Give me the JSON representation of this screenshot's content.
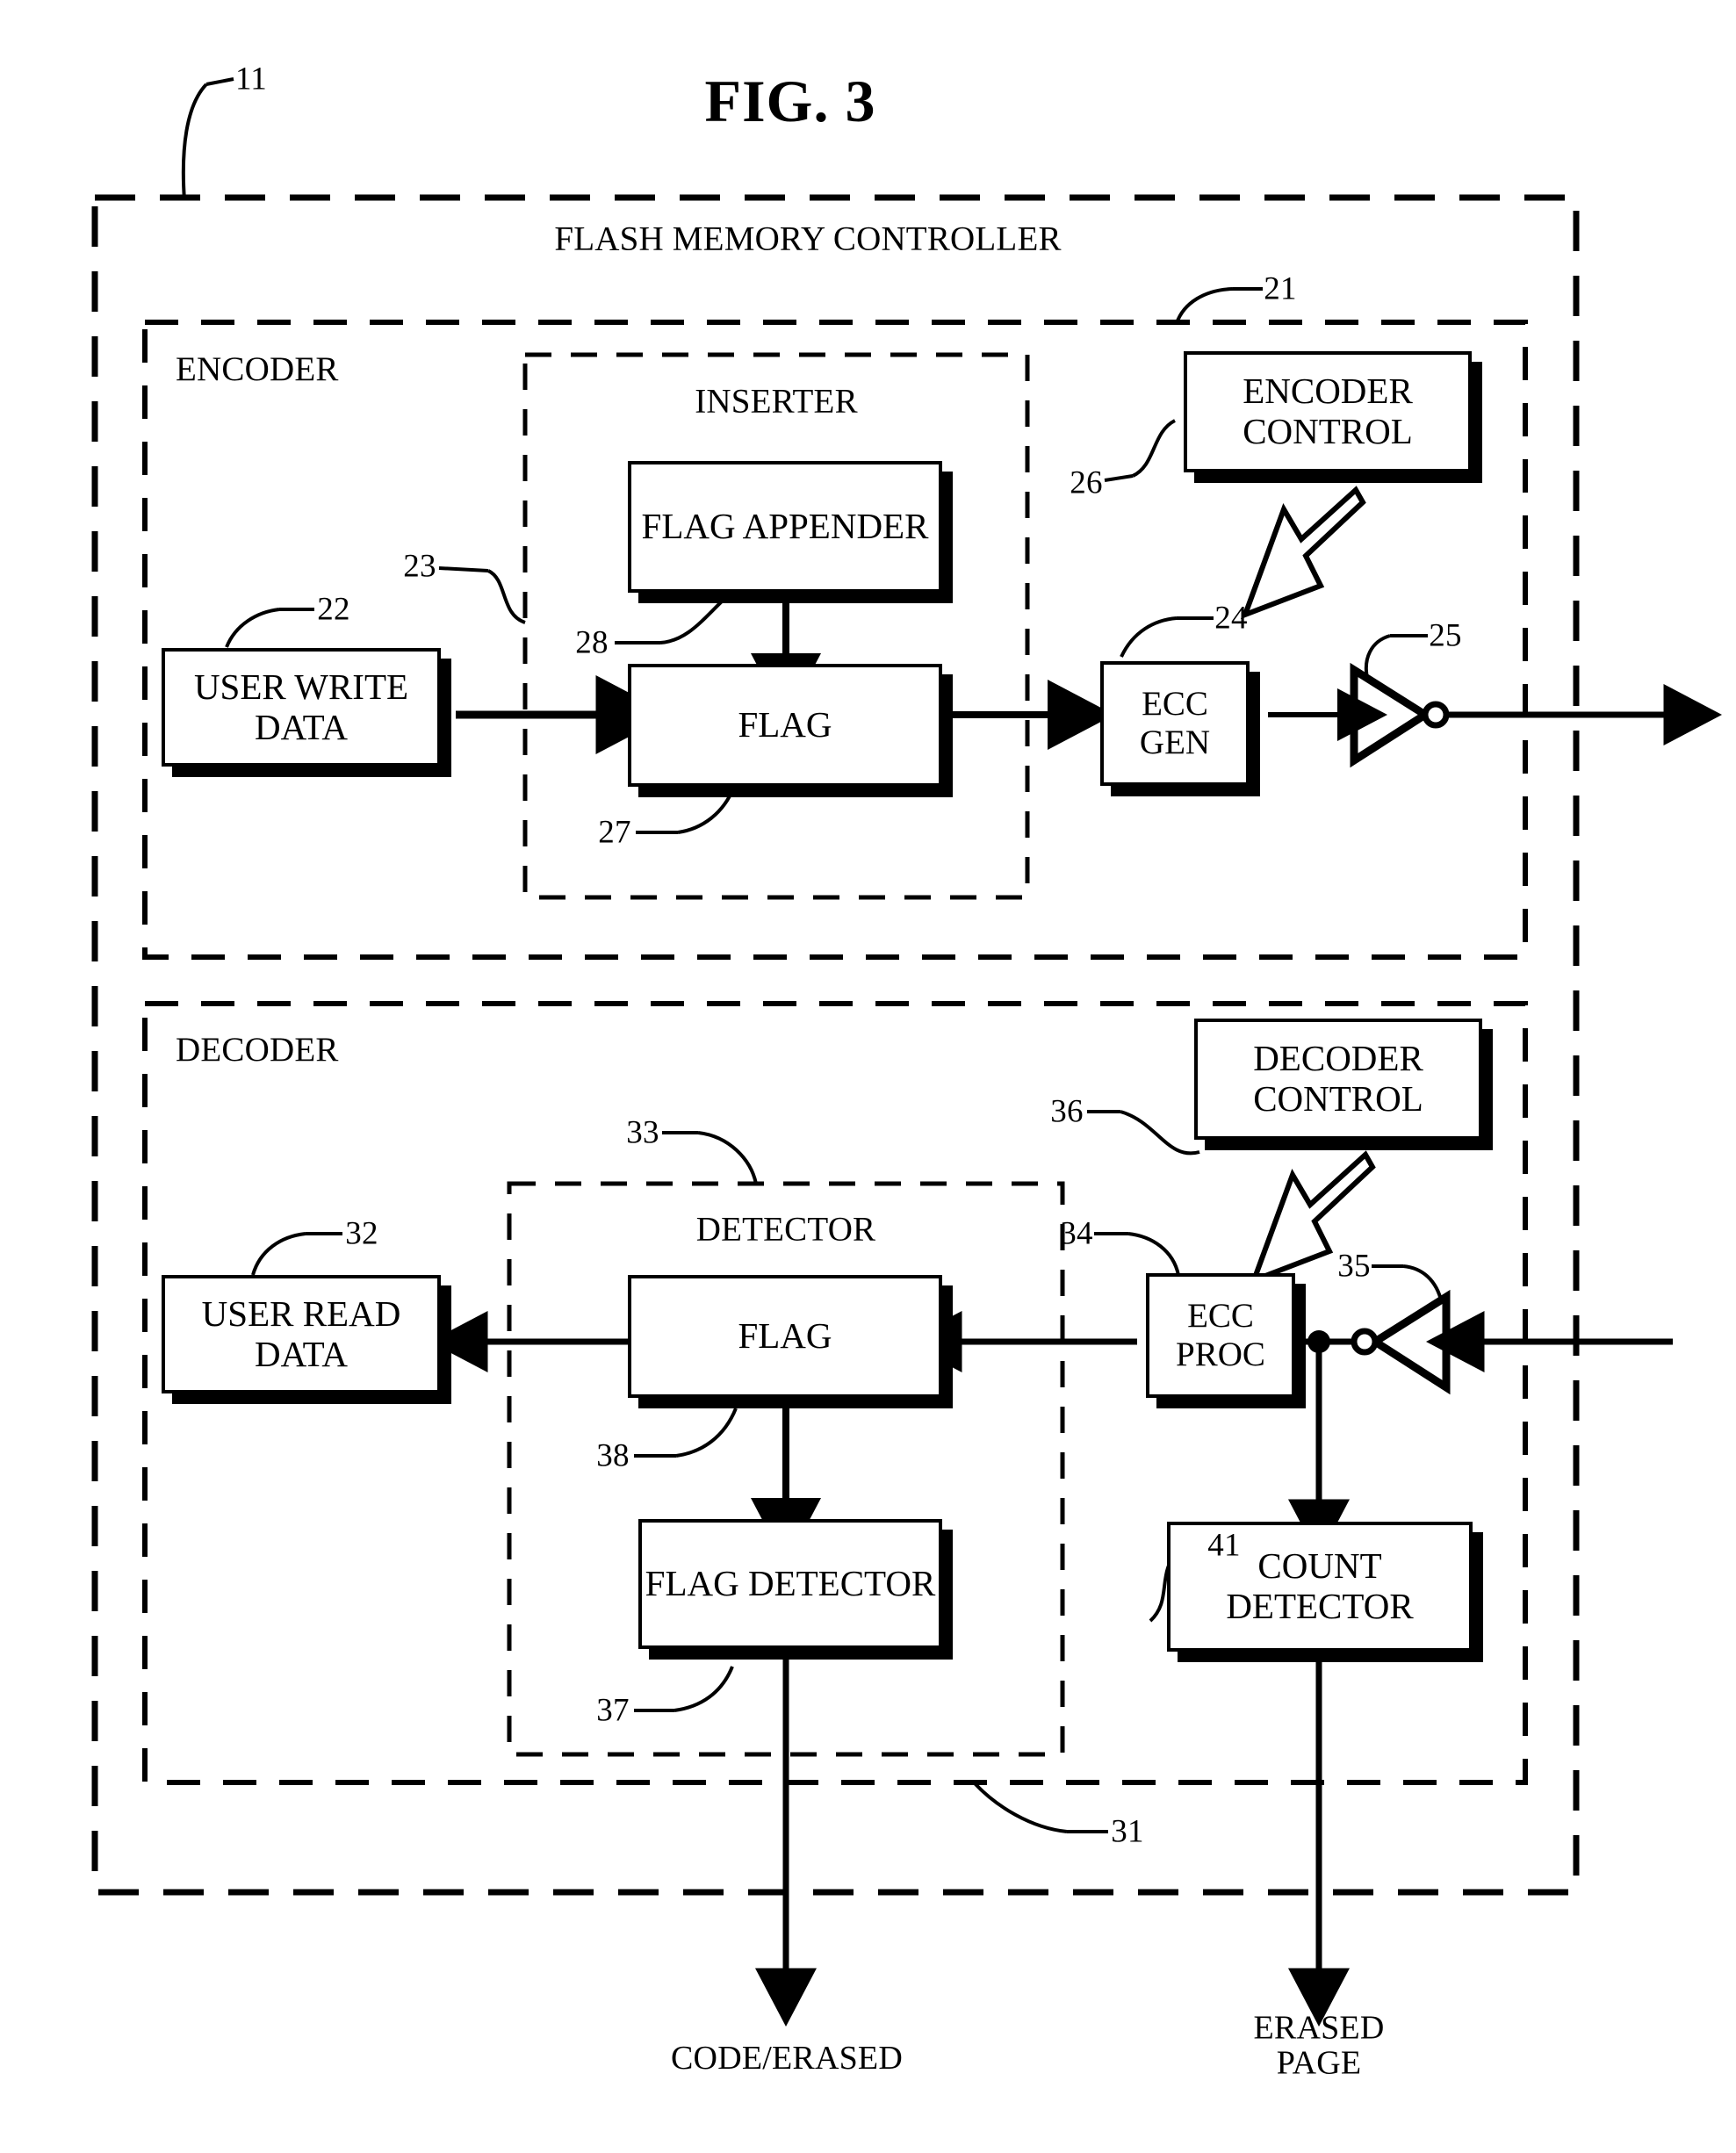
{
  "figure": {
    "title": "FIG. 3",
    "outer_ref": "11",
    "outer_title": "FLASH MEMORY CONTROLLER"
  },
  "encoder": {
    "title": "ENCODER",
    "ref": "21",
    "inserter": {
      "title": "INSERTER",
      "ref": "23"
    },
    "blocks": [
      {
        "label": "USER WRITE\nDATA",
        "ref": "22"
      },
      {
        "label": "FLAG\nAPPENDER",
        "ref": "28"
      },
      {
        "label": "FLAG",
        "ref": "27"
      },
      {
        "label": "ECC\nGEN",
        "ref": "24"
      },
      {
        "label": "ENCODER\nCONTROL",
        "ref": "26"
      }
    ],
    "inverter": {
      "name": "inverter",
      "ref": "25"
    }
  },
  "decoder": {
    "title": "DECODER",
    "ref": "31",
    "detector": {
      "title": "DETECTOR",
      "ref": "33"
    },
    "blocks": [
      {
        "label": "USER READ\nDATA",
        "ref": "32"
      },
      {
        "label": "FLAG",
        "ref": "38"
      },
      {
        "label": "FLAG\nDETECTOR",
        "ref": "37"
      },
      {
        "label": "ECC\nPROC",
        "ref": "34"
      },
      {
        "label": "DECODER\nCONTROL",
        "ref": "36"
      },
      {
        "label": "COUNT\nDETECTOR",
        "ref": "41"
      }
    ],
    "inverter": {
      "name": "inverter",
      "ref": "35"
    }
  },
  "outputs": [
    {
      "label": "CODE/ERASED"
    },
    {
      "label": "ERASED\nPAGE"
    }
  ],
  "colors": {
    "ink": "#000000",
    "paper": "#ffffff"
  }
}
